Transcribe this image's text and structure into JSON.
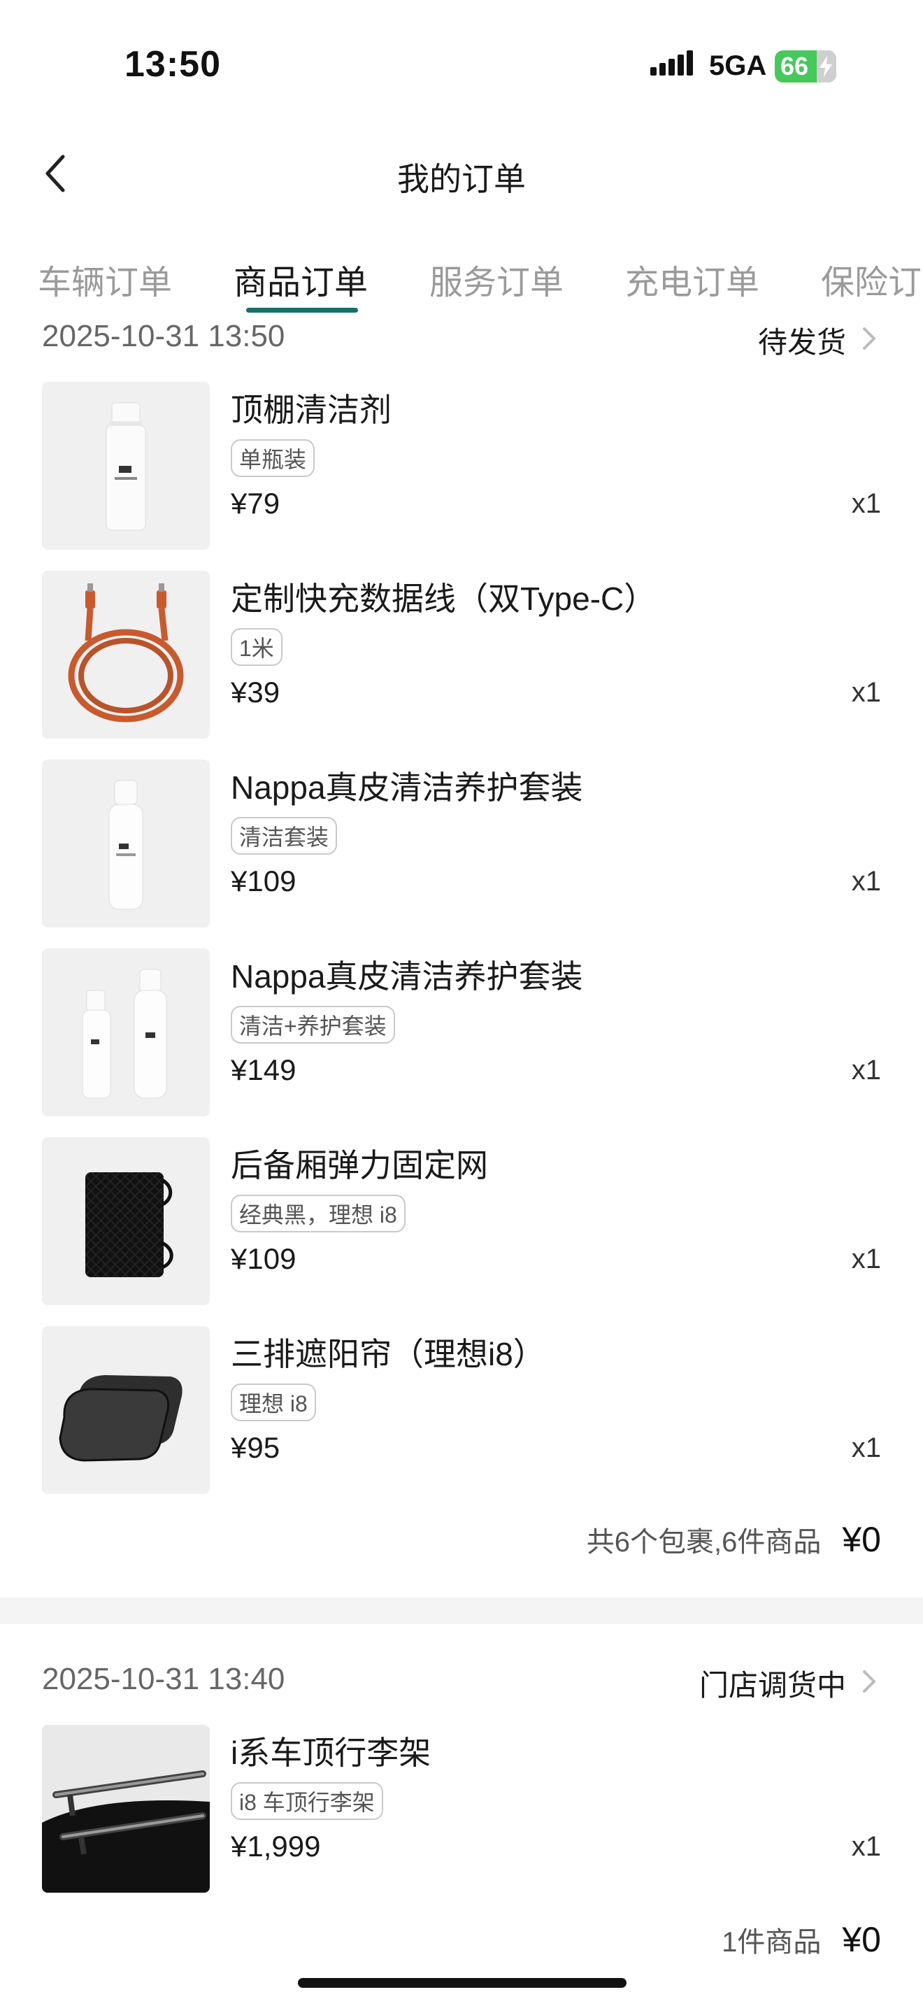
{
  "status_bar": {
    "time": "13:50",
    "network": "5GA",
    "battery": "66"
  },
  "header": {
    "title": "我的订单"
  },
  "tabs": [
    {
      "label": "车辆订单"
    },
    {
      "label": "商品订单"
    },
    {
      "label": "服务订单"
    },
    {
      "label": "充电订单"
    },
    {
      "label": "保险订"
    }
  ],
  "orders": [
    {
      "date": "2025-10-31 13:50",
      "status": "待发货",
      "items": [
        {
          "name": "顶棚清洁剂",
          "spec": "单瓶装",
          "price": "¥79",
          "qty": "x1",
          "icon": "cleaner-bottle-icon"
        },
        {
          "name": "定制快充数据线（双Type-C）",
          "spec": "1米",
          "price": "¥39",
          "qty": "x1",
          "icon": "usb-cable-icon"
        },
        {
          "name": "Nappa真皮清洁养护套装",
          "spec": "清洁套装",
          "price": "¥109",
          "qty": "x1",
          "icon": "foam-bottle-icon"
        },
        {
          "name": "Nappa真皮清洁养护套装",
          "spec": "清洁+养护套装",
          "price": "¥149",
          "qty": "x1",
          "icon": "two-bottles-icon"
        },
        {
          "name": "后备厢弹力固定网",
          "spec": "经典黑，理想 i8",
          "price": "¥109",
          "qty": "x1",
          "icon": "cargo-net-icon"
        },
        {
          "name": "三排遮阳帘（理想i8）",
          "spec": "理想 i8",
          "price": "¥95",
          "qty": "x1",
          "icon": "sunshade-icon"
        }
      ],
      "summary": {
        "text": "共6个包裹,6件商品",
        "total": "¥0"
      }
    },
    {
      "date": "2025-10-31 13:40",
      "status": "门店调货中",
      "items": [
        {
          "name": "i系车顶行李架",
          "spec": "i8 车顶行李架",
          "price": "¥1,999",
          "qty": "x1",
          "icon": "roof-rack-icon"
        }
      ],
      "summary": {
        "text": "1件商品",
        "total": "¥0"
      }
    }
  ],
  "colors": {
    "accent": "#176f67",
    "battery": "#46c85a",
    "divider": "#f4f4f4"
  }
}
